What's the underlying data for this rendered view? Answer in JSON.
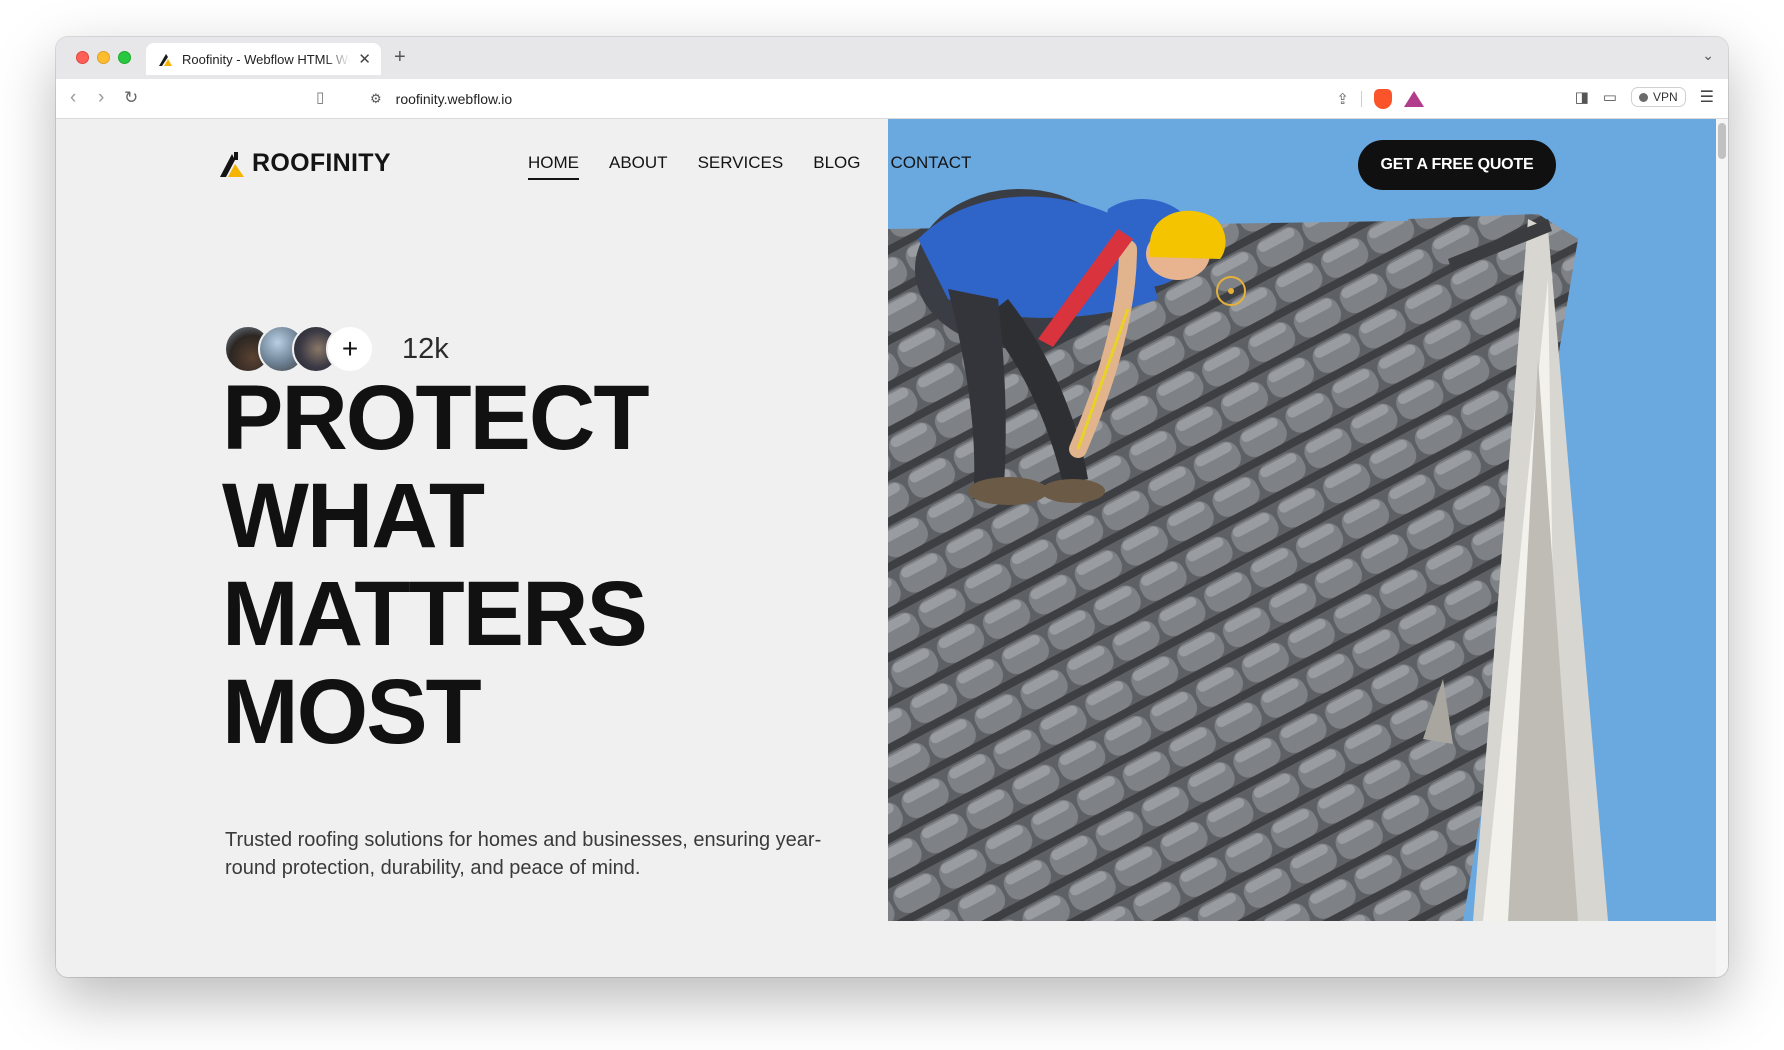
{
  "browser": {
    "tab_title": "Roofinity - Webflow HTML Website Template",
    "url": "roofinity.webflow.io",
    "vpn_label": "VPN",
    "icons": [
      "back-arrow-icon",
      "forward-arrow-icon",
      "reload-icon",
      "bookmark-icon",
      "site-info-icon",
      "share-icon",
      "brave-shield-icon",
      "brave-rewards-icon",
      "sidebar-icon",
      "wallet-icon",
      "menu-icon"
    ]
  },
  "site": {
    "logo": "ROOFINITY",
    "nav": [
      "HOME",
      "ABOUT",
      "SERVICES",
      "BLOG",
      "CONTACT"
    ],
    "active_nav": "HOME",
    "cta": "GET A FREE QUOTE",
    "social_proof_count": "12k",
    "headline": [
      "PROTECT",
      "WHAT",
      "MATTERS",
      "MOST"
    ],
    "subtitle": "Trusted roofing solutions for homes and businesses, ensuring year-round protection, durability, and peace of mind.",
    "colors": {
      "accent": "#ffcc00",
      "dark": "#111111",
      "sky": "#6aa8e0",
      "background": "#f0f0f1"
    }
  }
}
